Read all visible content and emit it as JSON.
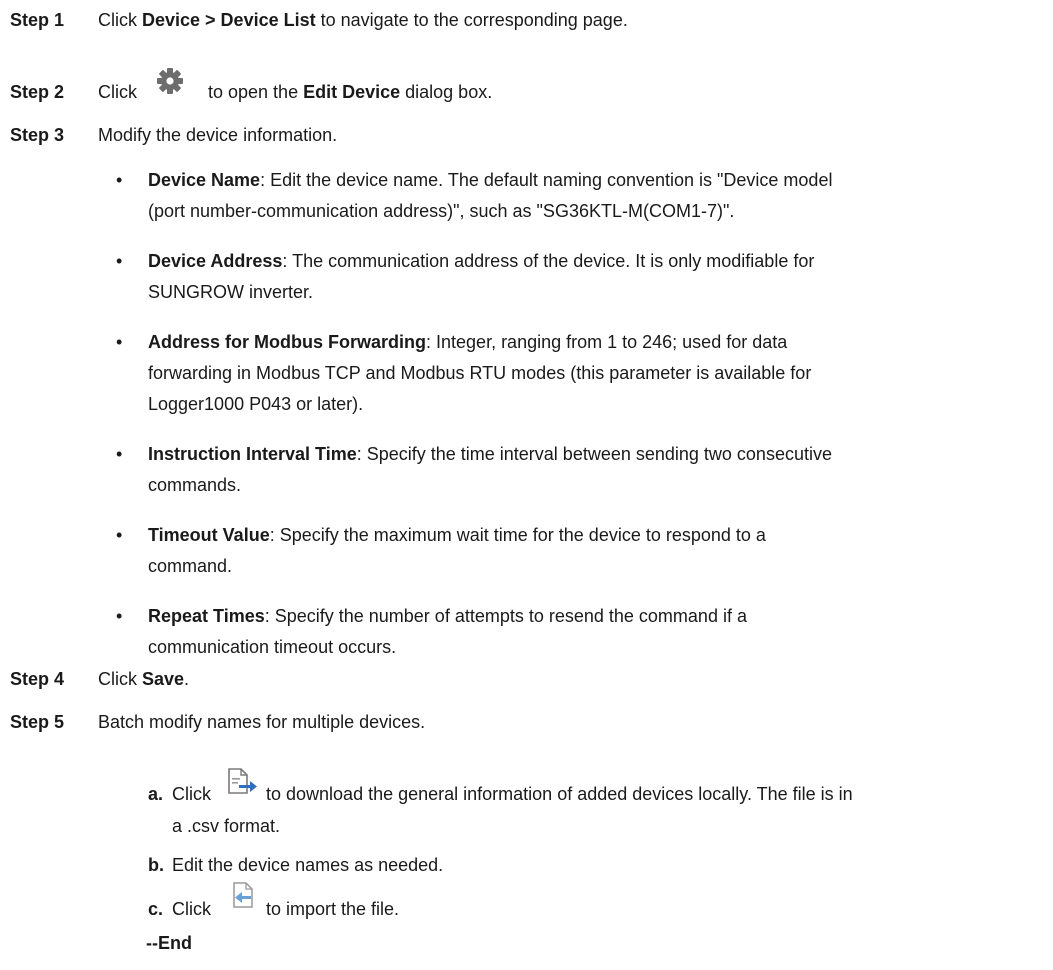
{
  "steps": {
    "step1": {
      "label": "Step 1",
      "pre": "Click ",
      "bold": "Device > Device List",
      "post": " to navigate to the corresponding page."
    },
    "step2": {
      "label": "Step 2",
      "pre": "Click",
      "icon": "gear-icon",
      "mid": "to open the ",
      "bold": "Edit Device",
      "post": " dialog box."
    },
    "step3": {
      "label": "Step 3",
      "text": "Modify the device information.",
      "bullets": [
        {
          "term": "Device Name",
          "lines": [
            ": Edit the device name. The default naming convention is \"Device model",
            "(port number-communication address)\", such as \"SG36KTL-M(COM1-7)\"."
          ]
        },
        {
          "term": "Device Address",
          "lines": [
            ": The communication address of the device. It is only modifiable for",
            "SUNGROW inverter."
          ]
        },
        {
          "term": "Address for Modbus Forwarding",
          "lines": [
            ": Integer, ranging from 1 to 246; used for data",
            "forwarding in Modbus TCP and Modbus RTU modes (this parameter is available for",
            "Logger1000 P043 or later)."
          ]
        },
        {
          "term": "Instruction Interval Time",
          "lines": [
            ": Specify the time interval between sending two consecutive",
            "commands."
          ]
        },
        {
          "term": "Timeout Value",
          "lines": [
            ": Specify the maximum wait time for the device to respond to a",
            "command."
          ]
        },
        {
          "term": "Repeat Times",
          "lines": [
            ": Specify the number of attempts to resend the command if a",
            "communication timeout occurs."
          ]
        }
      ]
    },
    "step4": {
      "label": "Step 4",
      "pre": "Click ",
      "bold": "Save",
      "post": "."
    },
    "step5": {
      "label": "Step 5",
      "text": "Batch modify names for multiple devices.",
      "subs": [
        {
          "letter": "a.",
          "pre": "Click",
          "icon": "export-file-icon",
          "lines": [
            "to download the general information of added devices locally. The file is in",
            "a .csv format."
          ]
        },
        {
          "letter": "b.",
          "lines": [
            "Edit the device names as needed."
          ]
        },
        {
          "letter": "c.",
          "pre": "Click",
          "icon": "import-file-icon",
          "lines": [
            "to import the file."
          ]
        }
      ]
    },
    "end": "--End"
  }
}
